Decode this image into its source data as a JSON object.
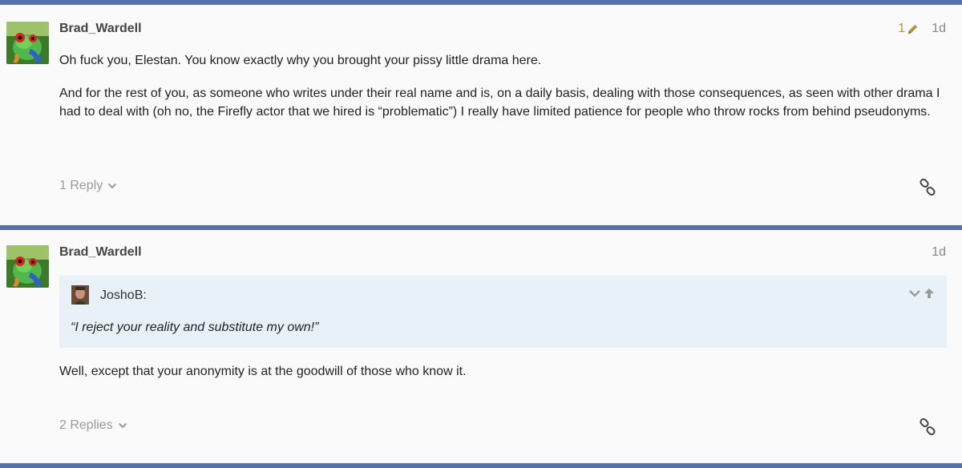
{
  "colors": {
    "divider": "#5470a6",
    "quote_bg": "#e9f1f8",
    "muted_text": "#9a9a9a",
    "edit_icon": "#b3933e"
  },
  "posts": [
    {
      "author": "Brad_Wardell",
      "edit_count": "1",
      "age": "1d",
      "paragraphs": [
        "Oh fuck you, Elestan. You know exactly why you brought your pissy little drama here.",
        "And for the rest of you, as someone who writes under their real name and is, on a daily basis, dealing with those consequences, as seen with other drama I had to deal with (oh no, the Firefly actor that we hired is “problematic”) I really have limited patience for people who throw rocks from behind pseudonyms."
      ],
      "replies_label": "1 Reply"
    },
    {
      "author": "Brad_Wardell",
      "age": "1d",
      "quote": {
        "author": "JoshoB:",
        "text": "“I reject your reality and substitute my own!”"
      },
      "paragraphs": [
        "Well, except that your anonymity is at the goodwill of those who know it."
      ],
      "replies_label": "2 Replies"
    }
  ],
  "icons": {
    "avatar": "frog-avatar",
    "edit": "pencil-icon",
    "expand": "chevron-down-icon",
    "link": "link-icon",
    "quote_expand": "chevron-down-icon",
    "quote_jump": "arrow-up-icon"
  }
}
